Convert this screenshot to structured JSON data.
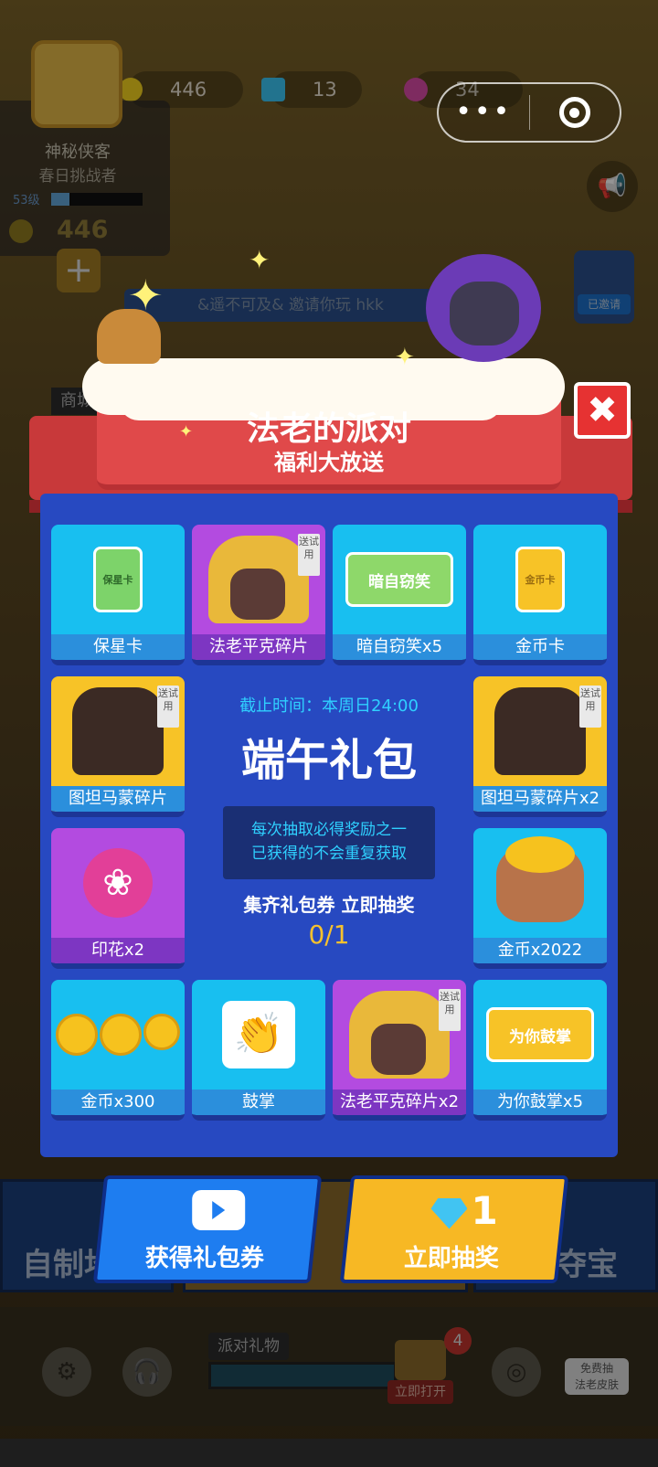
{
  "top_bar": {
    "coins": "446",
    "gems": "13",
    "stamps": "34"
  },
  "profile": {
    "name": "神秘侠客",
    "title": "春日挑战者",
    "level": "53级",
    "level_progress": 0.2,
    "gold": "446",
    "plus_symbol": "+"
  },
  "modal": {
    "title": "法老的派对",
    "subtitle": "福利大放送",
    "close_symbol": "✖",
    "trial_tag": "送试用",
    "rewards": [
      {
        "label": "保星卡",
        "icon": "shield-card-icon",
        "style": "cyan",
        "card_text": "保星卡"
      },
      {
        "label": "法老平克碎片",
        "icon": "pharaoh-pink-skin-icon",
        "style": "purple",
        "trial": true
      },
      {
        "label": "暗自窃笑x5",
        "icon": "smirk-sticker-icon",
        "style": "cyan",
        "card_text": "暗自窃笑"
      },
      {
        "label": "金币卡",
        "icon": "gold-card-icon",
        "style": "cyan",
        "card_text": "金币卡"
      },
      {
        "label": "图坦马蒙碎片",
        "icon": "tutan-horse-skin-icon",
        "style": "yellow",
        "trial": true
      },
      {
        "label": "图坦马蒙碎片x2",
        "icon": "tutan-horse-skin-icon",
        "style": "yellow",
        "trial": true
      },
      {
        "label": "印花x2",
        "icon": "stamp-flower-icon",
        "style": "purple"
      },
      {
        "label": "金币x2022",
        "icon": "gold-sack-icon",
        "style": "cyan"
      },
      {
        "label": "金币x300",
        "icon": "gold-coins-icon",
        "style": "cyan"
      },
      {
        "label": "鼓掌",
        "icon": "clap-sticker-icon",
        "style": "cyan"
      },
      {
        "label": "法老平克碎片x2",
        "icon": "pharaoh-pink-skin-icon",
        "style": "purple",
        "trial": true
      },
      {
        "label": "为你鼓掌x5",
        "icon": "clap-for-you-sticker-icon",
        "style": "cyan",
        "card_text": "为你鼓掌"
      }
    ],
    "deadline": "截止时间：本周日24:00",
    "package_name": "端午礼包",
    "info_line1": "每次抽取必得奖励之一",
    "info_line2": "已获得的不会重复获取",
    "collect_hint": "集齐礼包券 立即抽奖",
    "progress": "0/1",
    "get_ticket_label": "获得礼包券",
    "draw_label": "立即抽奖",
    "draw_cost": "1"
  },
  "background": {
    "banner_text": "&遥不可及& 邀请你玩 hkk",
    "shop_label": "商城",
    "mode_left": "自制地图",
    "mode_right": "每日夺宝",
    "party_gifts": "派对礼物",
    "open_now": "立即打开",
    "badge_count": "4",
    "free_draw_line1": "免费抽",
    "free_draw_line2": "法老皮肤",
    "invited": "已邀请"
  },
  "colors": {
    "panel_blue": "#2749c1",
    "cell_cyan": "#18bff0",
    "cell_purple": "#b34be0",
    "cell_yellow": "#f7c327",
    "banner_red": "#e0494a",
    "button_blue": "#1e7df0",
    "button_yellow": "#f7b824",
    "accent_cyan_text": "#2fd0ff",
    "progress_yellow": "#f6c12e"
  }
}
